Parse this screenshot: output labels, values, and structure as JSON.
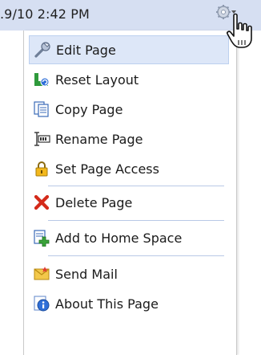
{
  "header": {
    "timestamp": ".9/10 2:42 PM",
    "actions_icon": "gear-icon"
  },
  "menu": {
    "items": [
      {
        "label": "Edit Page",
        "icon": "wrench-edit-icon",
        "highlighted": true
      },
      {
        "label": "Reset Layout",
        "icon": "reset-layout-icon"
      },
      {
        "label": "Copy Page",
        "icon": "copy-page-icon"
      },
      {
        "label": "Rename Page",
        "icon": "rename-page-icon"
      },
      {
        "label": "Set Page Access",
        "icon": "lock-icon"
      },
      {
        "label": "Delete Page",
        "icon": "delete-x-icon"
      },
      {
        "label": "Add to Home Space",
        "icon": "add-to-home-icon"
      },
      {
        "label": "Send Mail",
        "icon": "mail-icon"
      },
      {
        "label": "About This Page",
        "icon": "info-icon"
      }
    ]
  },
  "colors": {
    "topbar_bg": "#d6dff2",
    "highlight_bg": "#dde7f8",
    "separator": "#b9c9e6"
  }
}
